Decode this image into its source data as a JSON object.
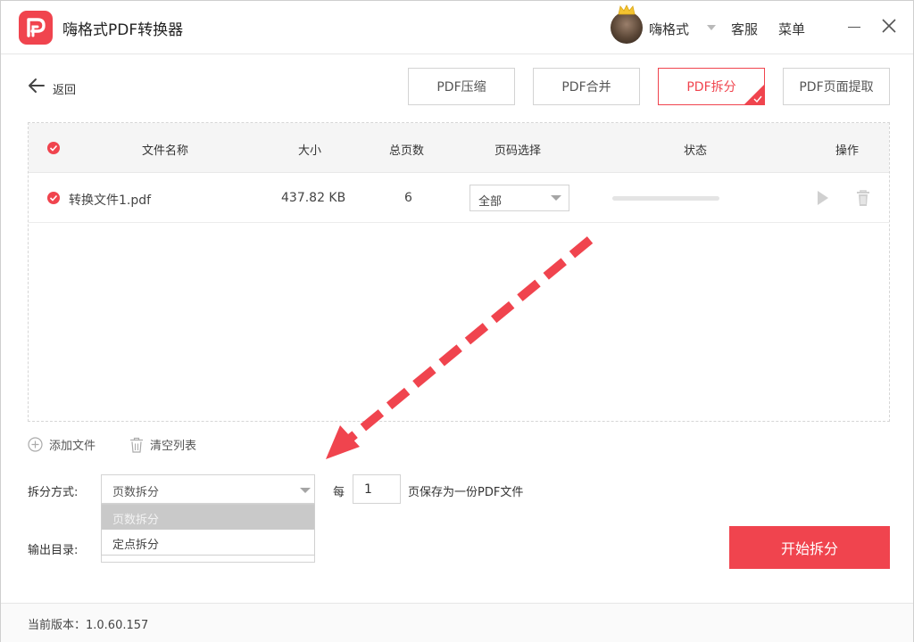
{
  "titlebar": {
    "app_title": "嗨格式PDF转换器",
    "username": "嗨格式",
    "service_label": "客服",
    "menu_label": "菜单"
  },
  "toolbar": {
    "back_label": "返回",
    "tools": [
      {
        "label": "PDF压缩",
        "active": false
      },
      {
        "label": "PDF合并",
        "active": false
      },
      {
        "label": "PDF拆分",
        "active": true
      },
      {
        "label": "PDF页面提取",
        "active": false
      }
    ]
  },
  "table": {
    "headers": {
      "name": "文件名称",
      "size": "大小",
      "pages": "总页数",
      "page_select": "页码选择",
      "status": "状态",
      "actions": "操作"
    },
    "rows": [
      {
        "name": "转换文件1.pdf",
        "size": "437.82 KB",
        "pages": "6",
        "page_select": "全部",
        "progress": 0
      }
    ]
  },
  "list_actions": {
    "add_file": "添加文件",
    "clear_list": "清空列表"
  },
  "split": {
    "mode_label": "拆分方式:",
    "mode_value": "页数拆分",
    "options": [
      "页数拆分",
      "定点拆分"
    ],
    "selected_option": "页数拆分",
    "every_label": "每",
    "pages_per_file": "1",
    "suffix_label": "页保存为一份PDF文件",
    "output_label": "输出目录:"
  },
  "start_button": "开始拆分",
  "footer": {
    "version_text": "当前版本：1.0.60.157"
  },
  "colors": {
    "accent": "#f0444e",
    "border": "#d3d3d3",
    "header_bg": "#f5f5f5"
  }
}
